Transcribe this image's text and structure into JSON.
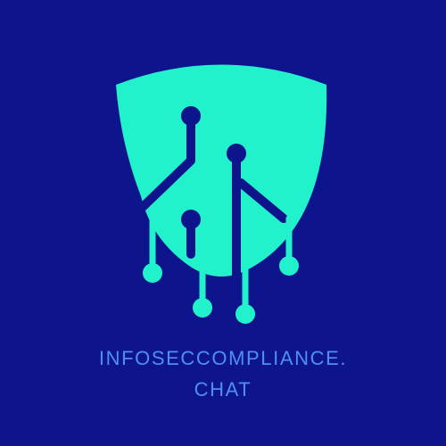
{
  "logo": {
    "icon": "shield-circuit-icon",
    "wordmark_line1": "INFOSECCOMPLIANCE.",
    "wordmark_line2": "CHAT"
  },
  "colors": {
    "background": "#0e148c",
    "shield": "#22f2cc",
    "circuit_dark": "#0e148c",
    "circuit_light": "#22f2cc",
    "wordmark": "#4f8ff2"
  }
}
